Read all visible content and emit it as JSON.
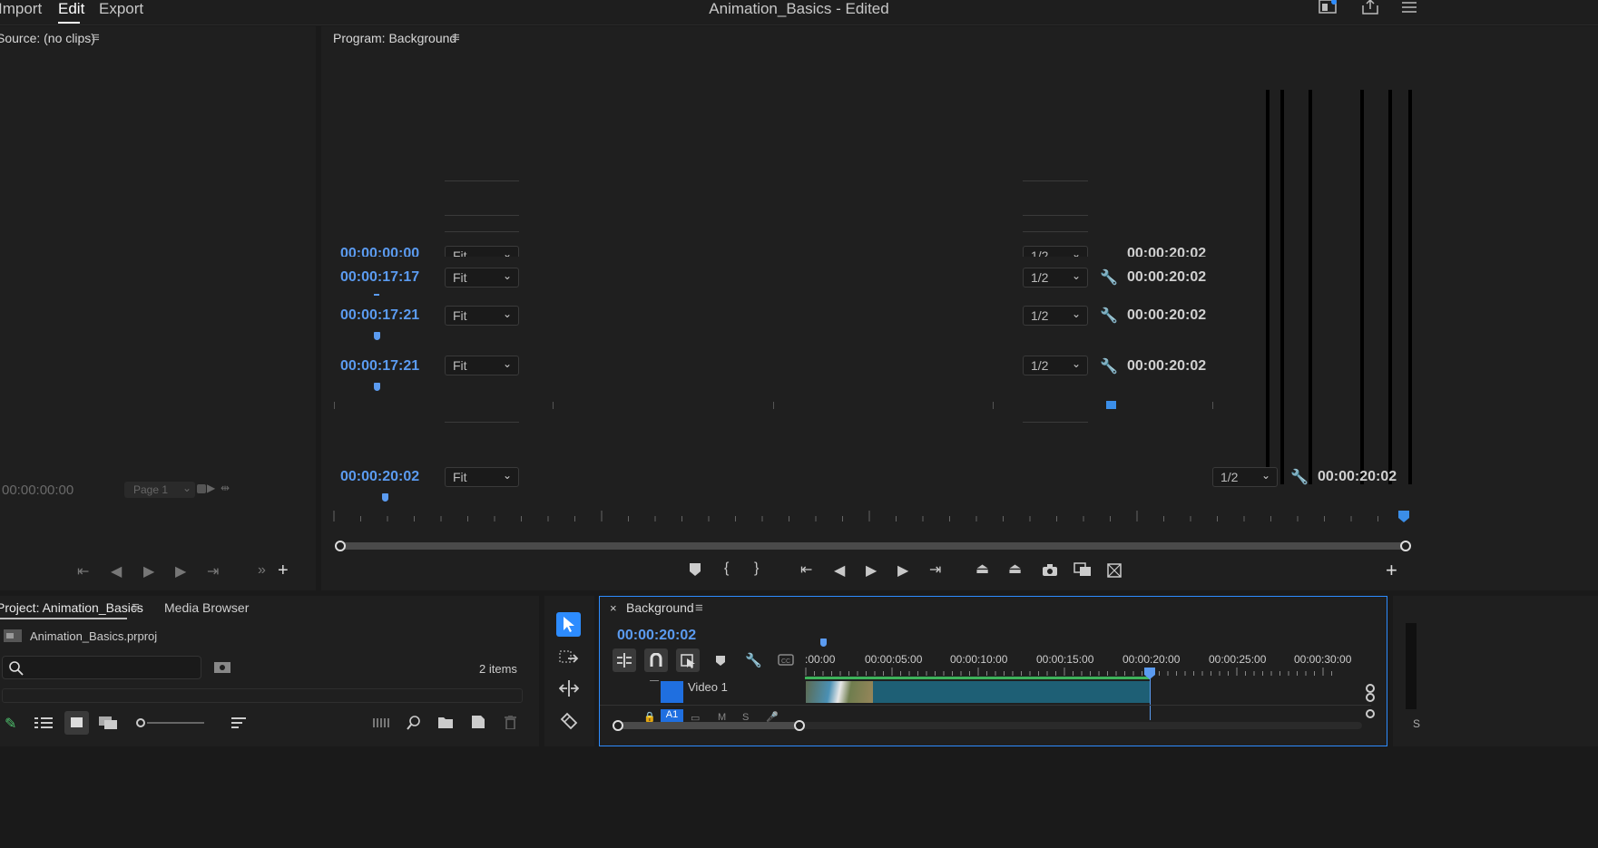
{
  "menu": {
    "import": "Import",
    "edit": "Edit",
    "export": "Export"
  },
  "window_title": "Animation_Basics - Edited",
  "source": {
    "title": "Source: (no clips)",
    "timecode": "00:00:00:00",
    "page_select": "Page 1"
  },
  "program": {
    "title": "Program: Background",
    "rows": [
      {
        "tc": "00:00:17:17",
        "fit": "Fit",
        "res": "1/2",
        "dur": "00:00:20:02"
      },
      {
        "tc": "00:00:17:21",
        "fit": "Fit",
        "res": "1/2",
        "dur": "00:00:20:02"
      },
      {
        "tc": "00:00:17:21",
        "fit": "Fit",
        "res": "1/2",
        "dur": "00:00:20:02"
      }
    ],
    "ghost_tc": "00:00:00:00",
    "ghost_fit": "Fit",
    "ghost_res": "1/2",
    "ghost_dur": "00:00:20:02",
    "timecode": "00:00:20:02",
    "fit": "Fit",
    "resolution": "1/2",
    "duration": "00:00:20:02"
  },
  "project": {
    "title": "Project: Animation_Basics",
    "media_browser": "Media Browser",
    "file": "Animation_Basics.prproj",
    "items_count": "2 items",
    "search_placeholder": ""
  },
  "timeline": {
    "close": "×",
    "title": "Background",
    "timecode": "00:00:20:02",
    "ruler": [
      ":00:00",
      "00:00:05:00",
      "00:00:10:00",
      "00:00:15:00",
      "00:00:20:00",
      "00:00:25:00",
      "00:00:30:00"
    ],
    "track_video": "Video 1",
    "track_audio": "A1"
  },
  "icons": {
    "tool_select": "arrow-icon",
    "tool_track": "track-select-icon",
    "tool_ripple": "ripple-icon",
    "tool_razor": "razor-icon"
  },
  "colors": {
    "accent": "#2d8cff",
    "timecode": "#5b9bf0",
    "clip": "#1e5f75"
  }
}
